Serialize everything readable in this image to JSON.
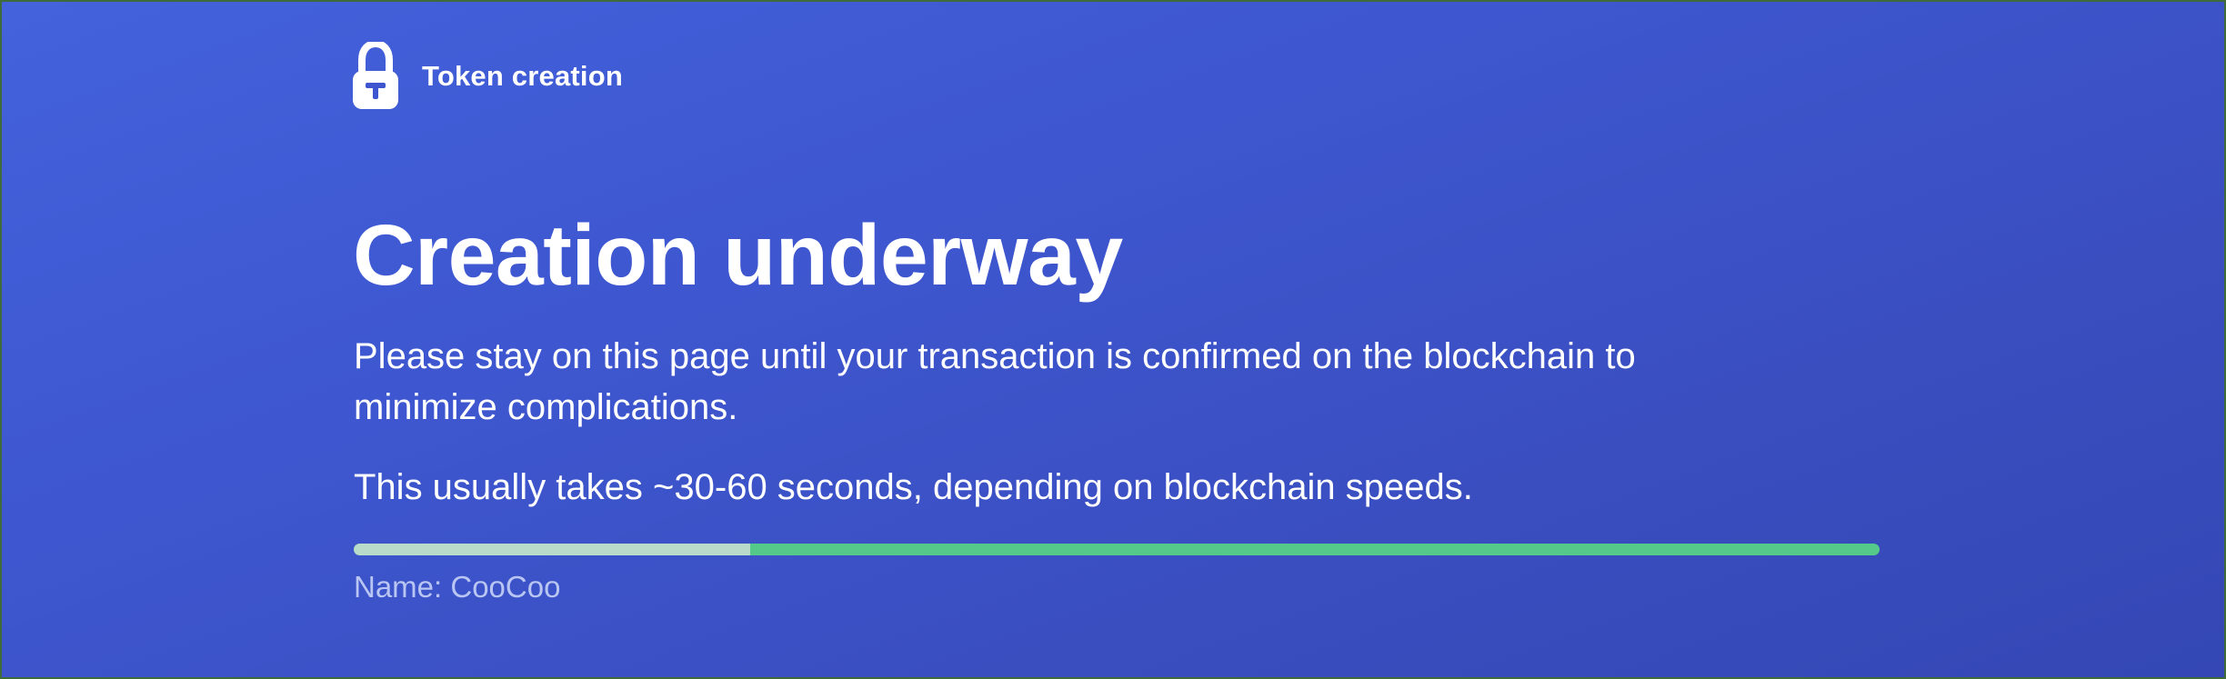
{
  "header": {
    "logo_icon": "padlock-t-icon",
    "title": "Token creation"
  },
  "main": {
    "headline": "Creation underway",
    "description": "Please stay on this page until your transaction is confirmed on the blockchain to minimize complications.",
    "note": "This usually takes ~30-60 seconds, depending on blockchain speeds.",
    "progress": 0.26,
    "token_name": "Name: CooCoo"
  },
  "colors": {
    "background": "#3e57d0",
    "progress_complete": "#b9dbc9",
    "progress_track": "#54c98a",
    "muted_text": "#b9c5f2"
  }
}
